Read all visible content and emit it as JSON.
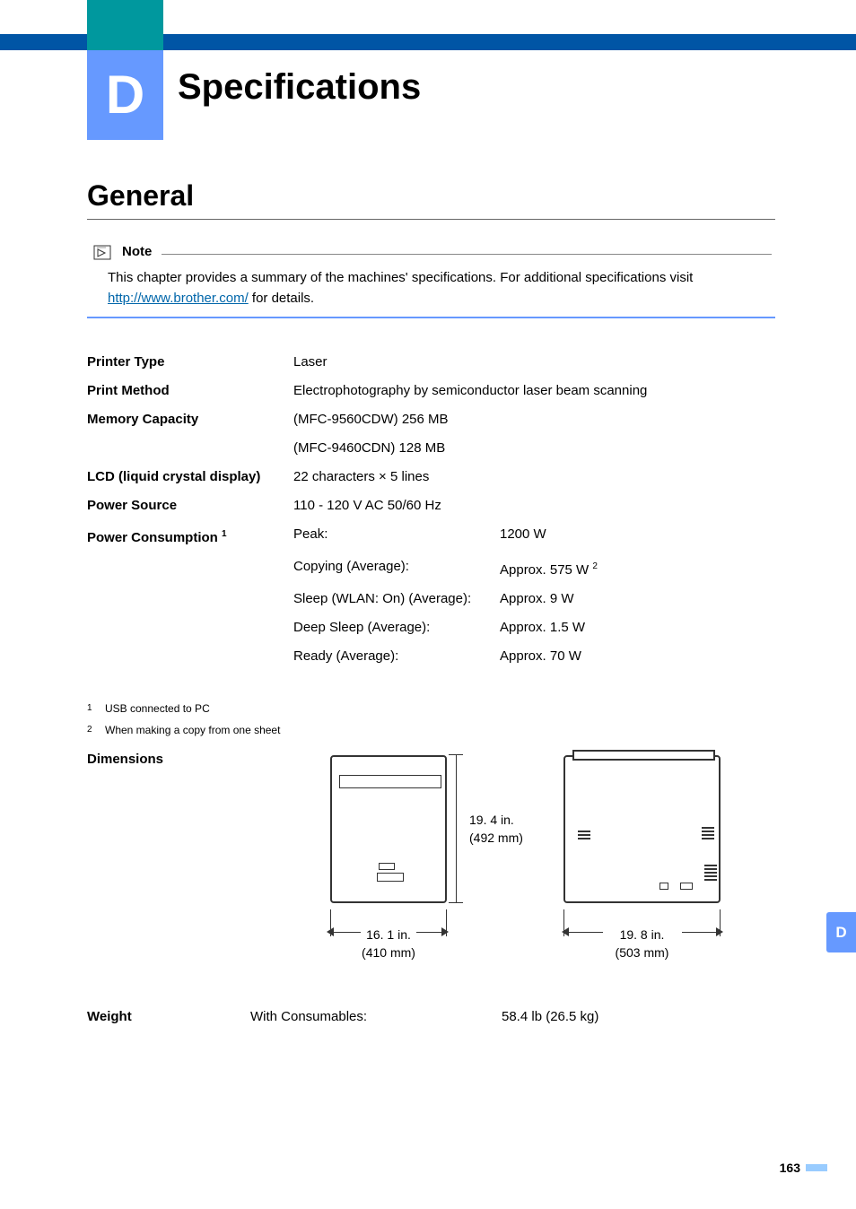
{
  "appendix_letter": "D",
  "chapter_title": "Specifications",
  "section_heading": "General",
  "note_label": "Note",
  "note_text_a": "This chapter provides a summary of the machines' specifications. For additional specifications visit ",
  "note_link_text": "http://www.brother.com/",
  "note_link_href": "http://www.brother.com/",
  "note_text_b": " for details.",
  "specs": {
    "printer_type": {
      "label": "Printer Type",
      "value": "Laser"
    },
    "print_method": {
      "label": "Print Method",
      "value": "Electrophotography by semiconductor laser beam scanning"
    },
    "memory_capacity": {
      "label": "Memory Capacity",
      "value1": "(MFC-9560CDW) 256 MB",
      "value2": "(MFC-9460CDN) 128 MB"
    },
    "lcd": {
      "label": "LCD (liquid crystal display)",
      "value": "22 characters × 5 lines"
    },
    "power_source": {
      "label": "Power Source",
      "value": "110 - 120 V AC 50/60 Hz"
    },
    "power_consumption": {
      "label": "Power Consumption",
      "footnote_ref": "1",
      "rows": [
        {
          "mode": "Peak:",
          "value": "1200 W"
        },
        {
          "mode": "Copying (Average):",
          "value": "Approx. 575 W",
          "value_footnote": "2"
        },
        {
          "mode": "Sleep (WLAN: On) (Average):",
          "value": "Approx. 9 W"
        },
        {
          "mode": "Deep Sleep (Average):",
          "value": "Approx. 1.5 W"
        },
        {
          "mode": "Ready (Average):",
          "value": "Approx. 70 W"
        }
      ]
    }
  },
  "footnotes": [
    {
      "ref": "1",
      "text": "USB connected to PC"
    },
    {
      "ref": "2",
      "text": "When making a copy from one sheet"
    }
  ],
  "dimensions": {
    "label": "Dimensions",
    "height": {
      "in": "19. 4 in.",
      "mm": "(492 mm)"
    },
    "width_front": {
      "in": "16. 1 in.",
      "mm": "(410 mm)"
    },
    "width_side": {
      "in": "19. 8 in.",
      "mm": "(503 mm)"
    }
  },
  "weight": {
    "label": "Weight",
    "mode": "With Consumables:",
    "value": "58.4 lb (26.5 kg)"
  },
  "right_tab": "D",
  "page_number": "163"
}
